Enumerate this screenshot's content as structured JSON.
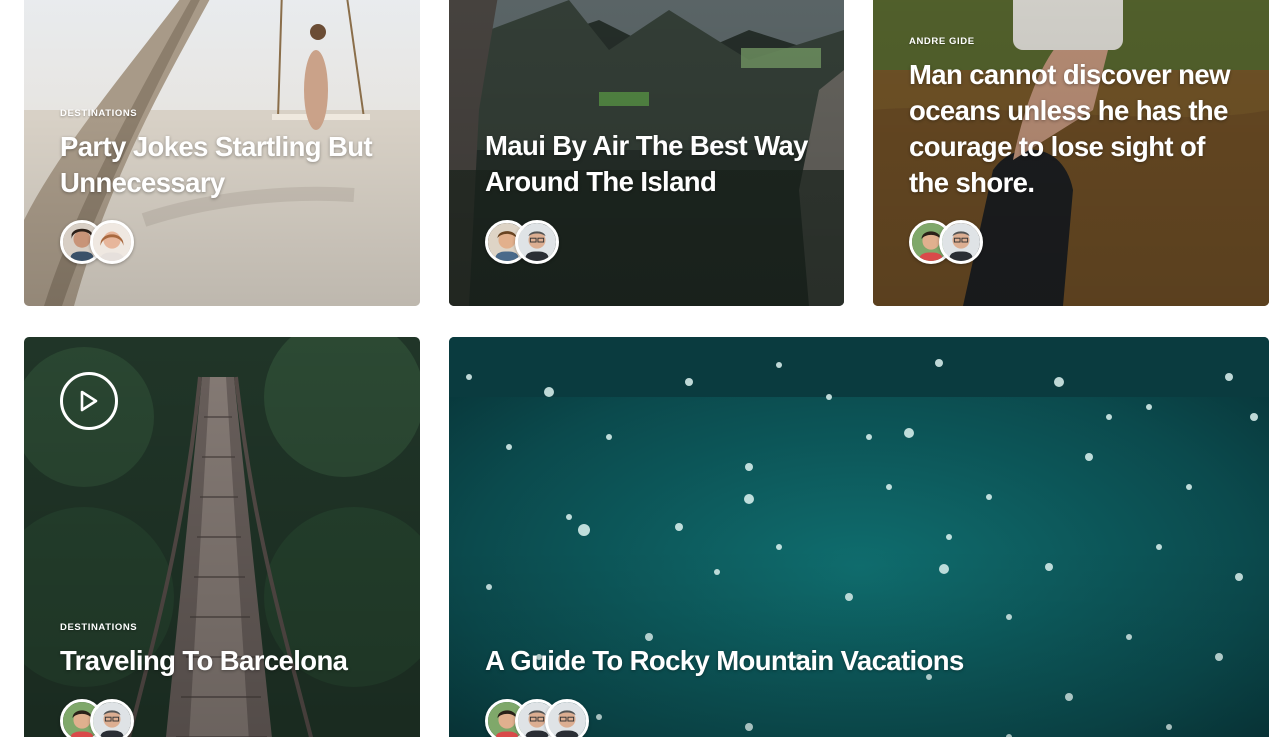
{
  "cards": [
    {
      "category": "Destinations",
      "title": "Party Jokes Startling But Unnecessary",
      "avatars": [
        "avatar-woman-dark-hair",
        "avatar-woman-auburn-hair"
      ]
    },
    {
      "category": "",
      "title": "Maui By Air The Best Way Around The Island",
      "avatars": [
        "avatar-boy",
        "avatar-man-glasses"
      ]
    },
    {
      "category": "Andre Gide",
      "title": "Man cannot discover new oceans unless he has the courage to lose sight of the shore.",
      "avatars": [
        "avatar-child",
        "avatar-man-glasses"
      ]
    },
    {
      "category": "Destinations",
      "title": "Traveling To Barcelona",
      "avatars": [
        "avatar-child",
        "avatar-man-glasses"
      ],
      "icon": "play-circle-icon"
    },
    {
      "category": "",
      "title": "A Guide To Rocky Mountain Vacations",
      "avatars": [
        "avatar-child",
        "avatar-man-glasses",
        "avatar-man-glasses"
      ]
    }
  ],
  "colors": {
    "text": "#ffffff",
    "beach": "#d9d4cc",
    "forest": "#2f3b33",
    "grass": "#6b5a2c",
    "jungle": "#233a29",
    "ocean": "#0f4d4f"
  }
}
